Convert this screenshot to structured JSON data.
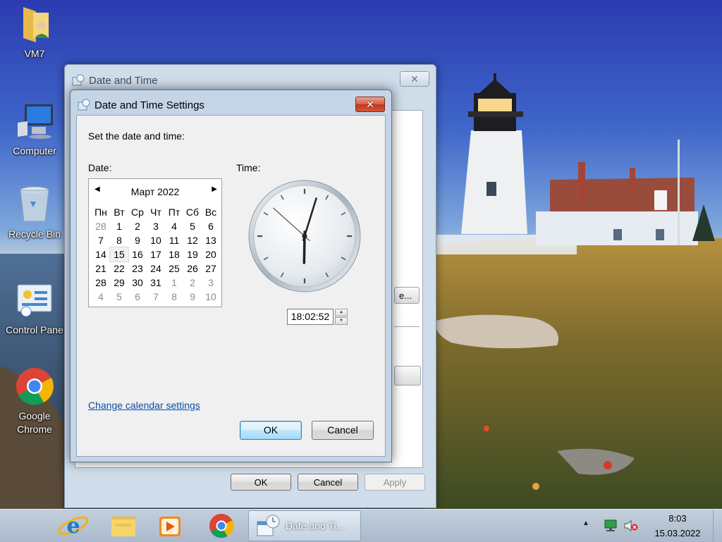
{
  "desktop": {
    "icons": [
      {
        "label": "VM7"
      },
      {
        "label": "Computer"
      },
      {
        "label": "Recycle Bin"
      },
      {
        "label": "Control Pane"
      },
      {
        "label": "Google\nChrome",
        "line1": "Google",
        "line2": "Chrome"
      }
    ]
  },
  "date_time_window": {
    "title": "Date and Time",
    "close_glyph": "✕",
    "partial_button_label": "e...",
    "ok_label": "OK",
    "cancel_label": "Cancel",
    "apply_label": "Apply"
  },
  "settings_dialog": {
    "title": "Date and Time Settings",
    "close_glyph": "✕",
    "instruction": "Set the date and time:",
    "date_label": "Date:",
    "time_label": "Time:",
    "calendar": {
      "month_title": "Март 2022",
      "prev_glyph": "◀",
      "next_glyph": "▶",
      "weekdays": [
        "Пн",
        "Вт",
        "Ср",
        "Чт",
        "Пт",
        "Сб",
        "Вс"
      ],
      "weeks": [
        [
          "28",
          "1",
          "2",
          "3",
          "4",
          "5",
          "6"
        ],
        [
          "7",
          "8",
          "9",
          "10",
          "11",
          "12",
          "13"
        ],
        [
          "14",
          "15",
          "16",
          "17",
          "18",
          "19",
          "20"
        ],
        [
          "21",
          "22",
          "23",
          "24",
          "25",
          "26",
          "27"
        ],
        [
          "28",
          "29",
          "30",
          "31",
          "1",
          "2",
          "3"
        ],
        [
          "4",
          "5",
          "6",
          "7",
          "8",
          "9",
          "10"
        ]
      ],
      "selected_day": "15"
    },
    "clock": {
      "hours": 18,
      "minutes": 2,
      "seconds": 52
    },
    "time_value": "18:02:52",
    "change_calendar_link": "Change calendar settings",
    "ok_label": "OK",
    "cancel_label": "Cancel"
  },
  "taskbar": {
    "active_window_label": "Date and Ti...",
    "tray_arrow": "▲",
    "clock_time": "8:03",
    "clock_date": "15.03.2022"
  },
  "colors": {
    "link": "#0a4ea6",
    "close_red": "#c0391e",
    "taskbar": "#aab9cb"
  }
}
